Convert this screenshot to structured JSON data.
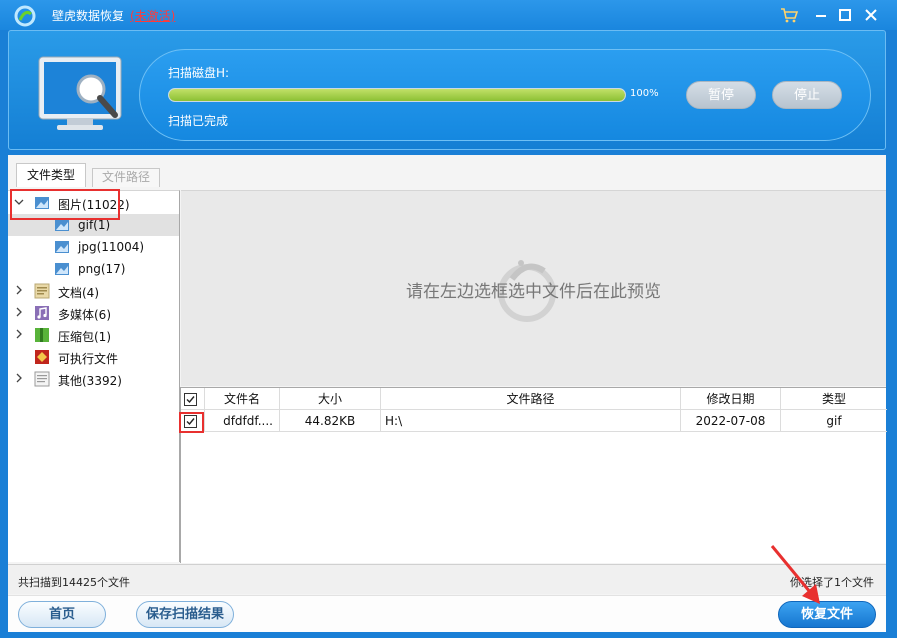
{
  "window": {
    "title": "壁虎数据恢复",
    "activation_status": "(未激活)"
  },
  "scan": {
    "disk_label": "扫描磁盘H:",
    "progress_percent": 100,
    "progress_text": "100%",
    "status_text": "扫描已完成",
    "pause_label": "暂停",
    "stop_label": "停止"
  },
  "tabs": {
    "file_type": "文件类型",
    "file_path": "文件路径"
  },
  "tree": {
    "images": {
      "label": "图片(11022)",
      "children": [
        {
          "label": "gif(1)"
        },
        {
          "label": "jpg(11004)"
        },
        {
          "label": "png(17)"
        }
      ]
    },
    "documents": {
      "label": "文档(4)"
    },
    "multimedia": {
      "label": "多媒体(6)"
    },
    "archives": {
      "label": "压缩包(1)"
    },
    "executables": {
      "label": "可执行文件"
    },
    "others": {
      "label": "其他(3392)"
    }
  },
  "preview": {
    "placeholder": "请在左边选框选中文件后在此预览"
  },
  "table": {
    "columns": [
      "文件名",
      "大小",
      "文件路径",
      "修改日期",
      "类型"
    ],
    "rows": [
      {
        "name": "dfdfdf....",
        "size": "44.82KB",
        "path": "H:\\",
        "date": "2022-07-08",
        "type": "gif",
        "checked": true
      }
    ]
  },
  "status": {
    "total": "共扫描到14425个文件",
    "selected": "你选择了1个文件"
  },
  "footer": {
    "home_label": "首页",
    "save_label": "保存扫描结果",
    "recover_label": "恢复文件"
  },
  "colors": {
    "titlebar": "#1a86de",
    "progress_fill": "#8cc034",
    "annotation": "#e8302f",
    "recover_button": "#1676d0"
  }
}
